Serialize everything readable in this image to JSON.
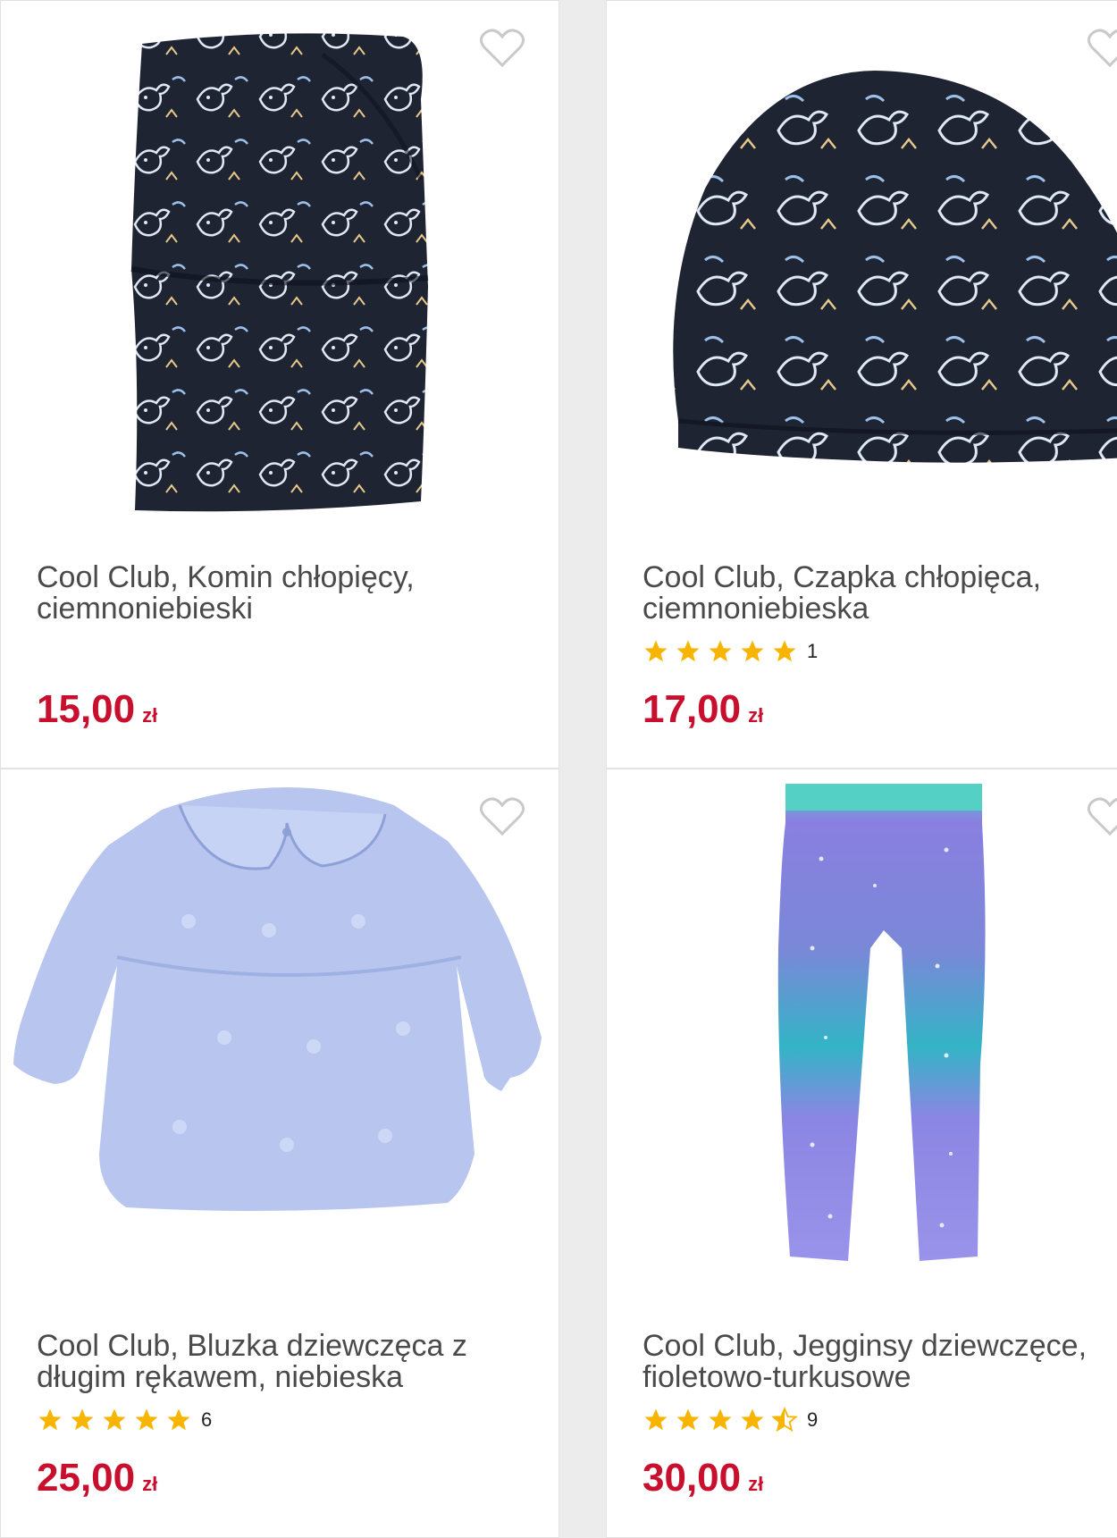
{
  "colors": {
    "price": "#c8102e",
    "star": "#f7b500",
    "heart": "#c9c9c9"
  },
  "products": [
    {
      "title": "Cool Club, Komin chłopięcy, ciemnoniebieski",
      "price": "15,00",
      "currency": "zł",
      "rating": null,
      "rating_count": null,
      "image_icon": "dino-print-snood-image"
    },
    {
      "title": "Cool Club, Czapka chłopięca, ciemnoniebieska",
      "price": "17,00",
      "currency": "zł",
      "rating": 5,
      "rating_count": "1",
      "image_icon": "dino-print-beanie-image"
    },
    {
      "title": "Cool Club, Bluzka dziewczęca z długim rękawem, niebieska",
      "price": "25,00",
      "currency": "zł",
      "rating": 5,
      "rating_count": "6",
      "image_icon": "blue-blouse-image"
    },
    {
      "title": "Cool Club, Jegginsy dziewczęce, fioletowo-turkusowe",
      "price": "30,00",
      "currency": "zł",
      "rating": 4.5,
      "rating_count": "9",
      "image_icon": "galaxy-leggings-image"
    }
  ]
}
